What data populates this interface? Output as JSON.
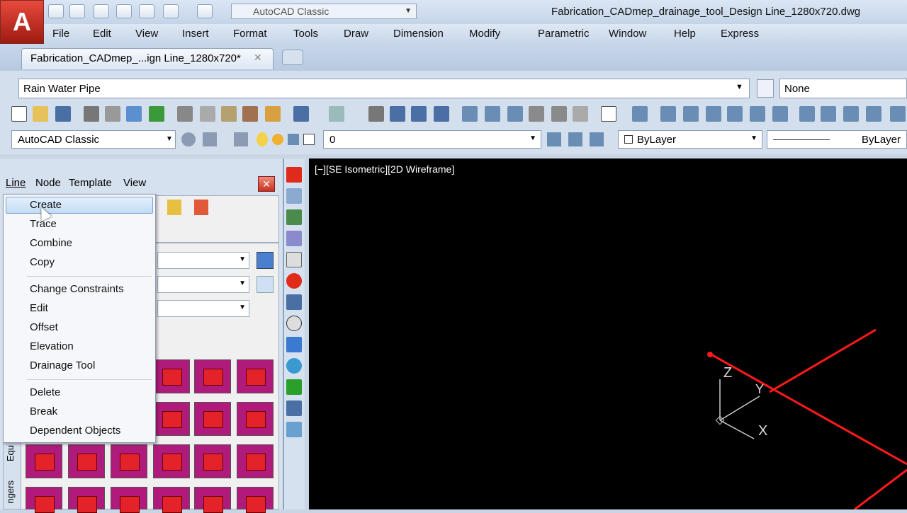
{
  "app": {
    "quick_access_workspace": "AutoCAD Classic",
    "document_title": "Fabrication_CADmep_drainage_tool_Design Line_1280x720.dwg"
  },
  "menubar": [
    "File",
    "Edit",
    "View",
    "Insert",
    "Format",
    "Tools",
    "Draw",
    "Dimension",
    "Modify",
    "Parametric",
    "Window",
    "Help",
    "Express"
  ],
  "doc_tab": {
    "label": "Fabrication_CADmep_...ign Line_1280x720*"
  },
  "service_bar": {
    "service": "Rain Water Pipe",
    "material": "None"
  },
  "props_bar": {
    "workspace": "AutoCAD Classic",
    "layer": "0",
    "color": "ByLayer",
    "linetype": "ByLayer"
  },
  "palette": {
    "menus": [
      "Line",
      "Node",
      "Template",
      "View"
    ],
    "side_tab_labels": [
      "Equ",
      "ngers"
    ]
  },
  "line_menu": {
    "items": [
      {
        "label": "Create",
        "highlighted": true
      },
      {
        "label": "Trace"
      },
      {
        "label": "Combine"
      },
      {
        "label": "Copy"
      },
      {
        "label": "Change Constraints"
      },
      {
        "label": "Edit"
      },
      {
        "label": "Offset"
      },
      {
        "label": "Elevation"
      },
      {
        "label": "Drainage Tool"
      },
      {
        "label": "Delete"
      },
      {
        "label": "Break"
      },
      {
        "label": "Dependent Objects"
      }
    ]
  },
  "viewport": {
    "label": "[−][SE Isometric][2D Wireframe]",
    "ucs_axes": [
      "Z",
      "Y",
      "X"
    ],
    "line_color": "#ff1a1a"
  },
  "colors": {
    "accent": "#c7d6ea",
    "fitting_fill": "#b01a7a",
    "fitting_part": "#e3222a"
  }
}
